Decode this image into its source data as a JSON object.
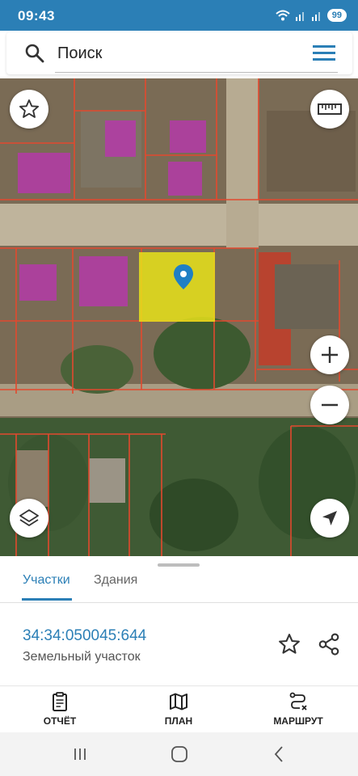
{
  "status_bar": {
    "time": "09:43",
    "battery": "99"
  },
  "search": {
    "placeholder": "Поиск"
  },
  "bottom_sheet": {
    "tabs": [
      {
        "label": "Участки",
        "active": true
      },
      {
        "label": "Здания",
        "active": false
      }
    ],
    "cadastral_number": "34:34:050045:644",
    "parcel_type": "Земельный участок"
  },
  "bottom_nav": {
    "items": [
      {
        "label": "ОТЧЁТ"
      },
      {
        "label": "ПЛАН"
      },
      {
        "label": "МАРШРУТ"
      }
    ]
  },
  "colors": {
    "accent": "#2b7fb6",
    "parcel_border": "#e2492e",
    "building_fill": "#b43aa8",
    "selected_fill": "#e8e21a"
  }
}
